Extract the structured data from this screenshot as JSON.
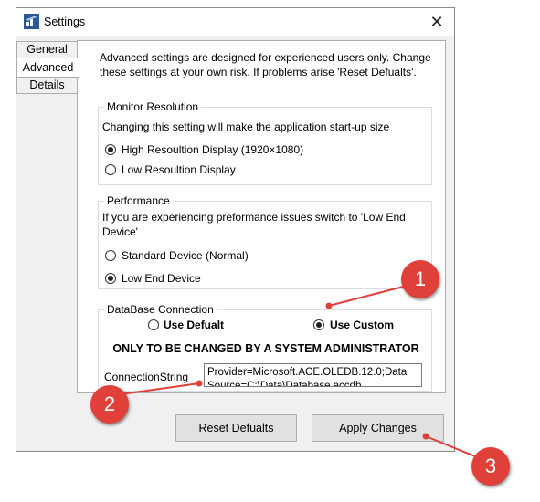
{
  "window": {
    "title": "Settings",
    "close_glyph": "✕"
  },
  "tabs": [
    {
      "label": "General",
      "active": false
    },
    {
      "label": "Advanced",
      "active": true
    },
    {
      "label": "Details",
      "active": false
    }
  ],
  "intro_text": "Advanced settings are designed for experienced users only. Change these settings at your own risk. If problems arise 'Reset Defualts'.",
  "monitor": {
    "legend": "Monitor Resolution",
    "description": "Changing this setting will make the application start-up size",
    "options": [
      {
        "label": "High Resoultion Display (1920×1080)",
        "selected": true
      },
      {
        "label": "Low Resoultion Display",
        "selected": false
      }
    ]
  },
  "performance": {
    "legend": "Performance",
    "description": "If you are experiencing preformance issues switch to 'Low End Device'",
    "options": [
      {
        "label": "Standard Device (Normal)",
        "selected": false
      },
      {
        "label": "Low End Device",
        "selected": true
      }
    ]
  },
  "database": {
    "legend": "DataBase Connection",
    "options": [
      {
        "label": "Use Defualt",
        "selected": false
      },
      {
        "label": "Use Custom",
        "selected": true
      }
    ],
    "warning": "ONLY TO BE CHANGED BY A SYSTEM ADMINISTRATOR",
    "conn_label": "ConnectionString",
    "conn_value": "Provider=Microsoft.ACE.OLEDB.12.0;Data Source=C:\\Data\\Database.accdb"
  },
  "buttons": {
    "reset": "Reset Defualts",
    "apply": "Apply Changes"
  },
  "callouts": [
    "1",
    "2",
    "3"
  ],
  "colors": {
    "callout": "#e0403a",
    "window_bg": "#f0f0f0",
    "panel_bg": "#ffffff",
    "button_bg": "#e1e1e1"
  },
  "icons": {
    "app": "settings-app-icon",
    "close": "close-icon"
  }
}
